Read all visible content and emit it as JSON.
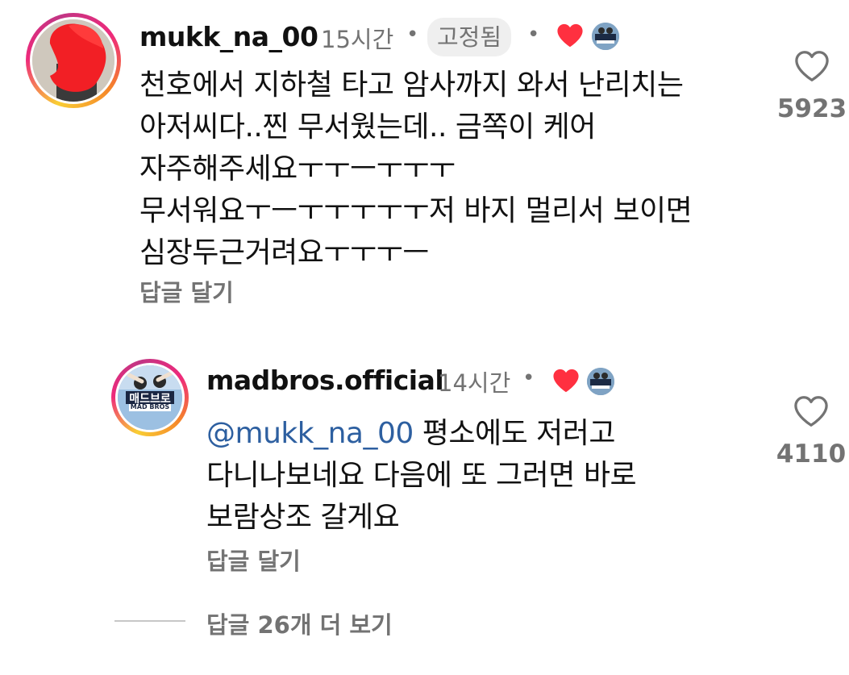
{
  "comments": [
    {
      "username": "mukk_na_00",
      "time": "15시간",
      "pinned_label": "고정됨",
      "lines": [
        "천호에서 지하철 타고 암사까지 와서 난리치는",
        "아저씨다..찐 무서웠는데.. 금쪽이 케어",
        "자주해주세요ㅜㅜㅡㅜㅜㅜ",
        "무서워요ㅜㅡㅜㅜㅜㅜㅜ저 바지 멀리서 보이면",
        "심장두근거려요ㅜㅜㅜㅡ"
      ],
      "reply_label": "답글 달기",
      "like_count": "5923"
    },
    {
      "username": "madbros.official",
      "time": "14시간",
      "mention": "@mukk_na_00",
      "lines": [
        " 평소에도 저러고",
        "다니나보네요 다음에 또 그러면 바로",
        "보람상조 갈게요"
      ],
      "reply_label": "답글 달기",
      "like_count": "4110",
      "avatar_text_top": "매드브로",
      "avatar_text_bottom": "MAD BROS"
    }
  ],
  "more_replies_label": "답글 26개 더 보기",
  "colors": {
    "heart": "#ff3040",
    "meta": "#737373",
    "mention": "#2d5fa0"
  }
}
